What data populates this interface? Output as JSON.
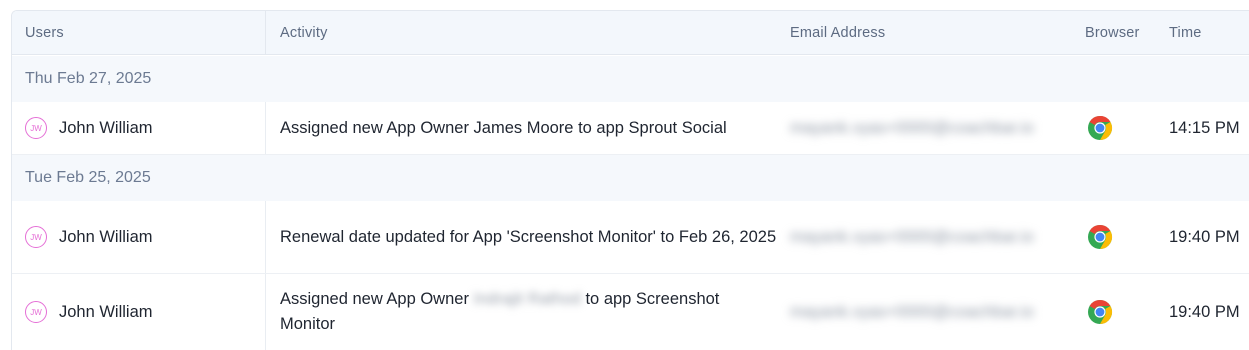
{
  "headers": {
    "users": "Users",
    "activity": "Activity",
    "email": "Email Address",
    "browser": "Browser",
    "time": "Time"
  },
  "groups": [
    {
      "date": "Thu Feb 27, 2025"
    },
    {
      "date": "Tue Feb 25, 2025"
    }
  ],
  "rows": [
    {
      "initials": "JW",
      "user": "John William",
      "activity": "Assigned new App Owner James Moore to app Sprout Social",
      "email": "mayank.vyas+0000@coachbar.io",
      "browser_icon": "chrome-icon",
      "time": "14:15 PM"
    },
    {
      "initials": "JW",
      "user": "John William",
      "activity": "Renewal date updated for App 'Screenshot Monitor' to Feb 26, 2025",
      "email": "mayank.vyas+0000@coachbar.io",
      "browser_icon": "chrome-icon",
      "time": "19:40 PM"
    },
    {
      "initials": "JW",
      "user": "John William",
      "activity_pre": "Assigned new App Owner",
      "activity_blurred": "Indrajit Rathod",
      "activity_post": "to app Screenshot Monitor",
      "email": "mayank.vyas+0000@coachbar.io",
      "browser_icon": "chrome-icon",
      "time": "19:40 PM"
    }
  ],
  "colors": {
    "avatar": "#e56fd6",
    "header_bg": "#f3f7fc",
    "group_bg": "#f5f8fc"
  }
}
